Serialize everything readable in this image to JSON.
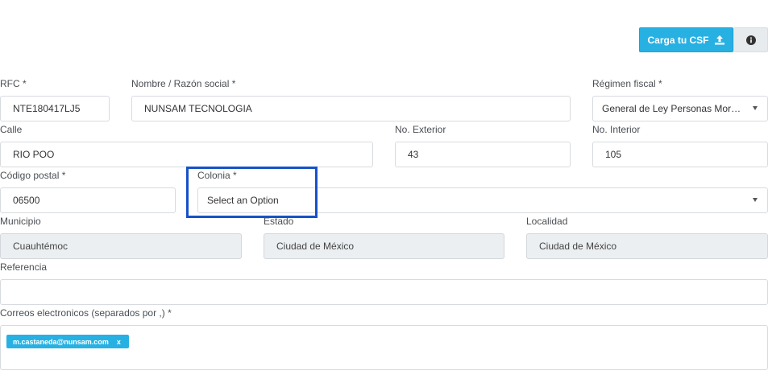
{
  "toolbar": {
    "upload_label": "Carga tu CSF",
    "upload_icon": "upload-icon",
    "info_icon": "info-icon",
    "accent": "#27b1e3"
  },
  "form": {
    "rfc": {
      "label": "RFC *",
      "value": "NTE180417LJ5"
    },
    "nombre": {
      "label": "Nombre / Razón social *",
      "value": "NUNSAM TECNOLOGIA"
    },
    "regimen": {
      "label": "Régimen fiscal *",
      "value": "General de Ley Personas Mora…"
    },
    "calle": {
      "label": "Calle",
      "value": "RIO POO"
    },
    "no_exterior": {
      "label": "No. Exterior",
      "value": "43"
    },
    "no_interior": {
      "label": "No. Interior",
      "value": "105"
    },
    "codigo_postal": {
      "label": "Código postal *",
      "value": "06500"
    },
    "colonia": {
      "label": "Colonia *",
      "placeholder": "Select an Option"
    },
    "municipio": {
      "label": "Municipio",
      "value": "Cuauhtémoc"
    },
    "estado": {
      "label": "Estado",
      "value": "Ciudad de México"
    },
    "localidad": {
      "label": "Localidad",
      "value": "Ciudad de México"
    },
    "referencia": {
      "label": "Referencia",
      "value": ""
    },
    "correos": {
      "label": "Correos electronicos (separados por ,) *",
      "tags": [
        {
          "email": "m.castaneda@nunsam.com",
          "remove": "x"
        }
      ]
    }
  },
  "highlight_color": "#1652c8"
}
